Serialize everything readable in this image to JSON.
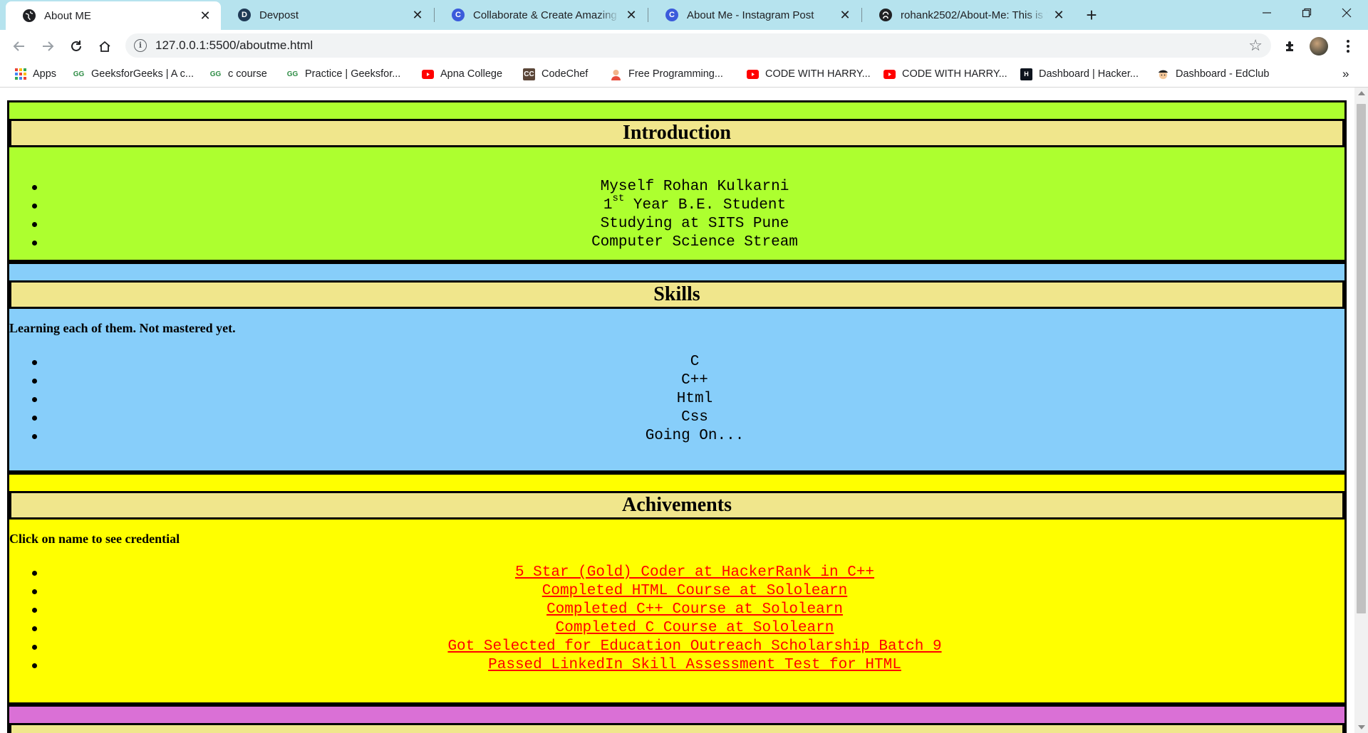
{
  "browser": {
    "tabs": [
      {
        "title": "About ME",
        "icon": "globe-icon",
        "active": true
      },
      {
        "title": "Devpost",
        "icon": "devpost-icon",
        "active": false
      },
      {
        "title": "Collaborate & Create Amazing G",
        "icon": "canva-icon",
        "active": false
      },
      {
        "title": "About Me - Instagram Post",
        "icon": "canva-icon",
        "active": false
      },
      {
        "title": "rohank2502/About-Me: This is \"A",
        "icon": "github-icon",
        "active": false
      }
    ],
    "url": "127.0.0.1:5500/aboutme.html"
  },
  "bookmarks": [
    {
      "label": "Apps",
      "icon": "apps-grid-icon"
    },
    {
      "label": "GeeksforGeeks | A c...",
      "icon": "gfg-icon"
    },
    {
      "label": "c course",
      "icon": "gfg-icon"
    },
    {
      "label": "Practice | Geeksfor...",
      "icon": "gfg-icon"
    },
    {
      "label": "Apna College",
      "icon": "youtube-icon"
    },
    {
      "label": "CodeChef",
      "icon": "codechef-icon"
    },
    {
      "label": "Free Programming...",
      "icon": "avatar-icon"
    },
    {
      "label": "CODE WITH HARRY...",
      "icon": "youtube-icon"
    },
    {
      "label": "CODE WITH HARRY...",
      "icon": "youtube-icon"
    },
    {
      "label": "Dashboard | Hacker...",
      "icon": "hackerrank-icon"
    },
    {
      "label": "Dashboard - EdClub",
      "icon": "edclub-icon"
    }
  ],
  "page": {
    "introduction": {
      "heading": "Introduction",
      "items": [
        {
          "text": "Myself Rohan Kulkarni"
        },
        {
          "prefix": "1",
          "sup": "st",
          "text": " Year B.E. Student"
        },
        {
          "text": "Studying at SITS Pune"
        },
        {
          "text": "Computer Science Stream"
        }
      ]
    },
    "skills": {
      "heading": "Skills",
      "note": "Learning each of them. Not mastered yet.",
      "items": [
        "C",
        "C++",
        "Html",
        "Css",
        "Going On..."
      ]
    },
    "achievements": {
      "heading": "Achivements",
      "note": "Click on name to see credential",
      "items": [
        "5 Star (Gold) Coder at HackerRank in C++",
        "Completed HTML Course at Sololearn",
        "Completed C++ Course at Sololearn",
        "Completed C Course at Sololearn",
        "Got Selected for Education Outreach Scholarship Batch 9",
        "Passed LinkedIn Skill Assessment Test for HTML"
      ]
    }
  },
  "colors": {
    "intro_bg": "#adff2f",
    "skills_bg": "#87cefa",
    "achievements_bg": "#ffff00",
    "next_bg": "#da70d6",
    "heading_bg": "#f0e68c",
    "link": "#ff0000"
  }
}
